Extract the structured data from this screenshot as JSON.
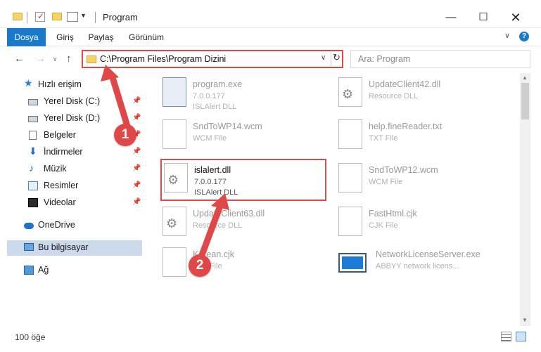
{
  "window": {
    "title": "Program",
    "min": "—",
    "max": "☐",
    "close": "✕"
  },
  "ribbon": {
    "tabs": [
      "Dosya",
      "Giriş",
      "Paylaş",
      "Görünüm"
    ],
    "chevron": "∨",
    "help": "?"
  },
  "nav": {
    "back": "←",
    "forward": "→",
    "recent": "∨",
    "up": "↑",
    "refresh": "↻",
    "drop": "∨"
  },
  "address": {
    "path": "C:\\Program Files\\Program Dizini"
  },
  "search": {
    "placeholder": "Ara: Program"
  },
  "sidebar": {
    "items": [
      {
        "label": "Hızlı erişim",
        "icon": "star-icon"
      },
      {
        "label": "Yerel Disk (C:)",
        "icon": "drive-icon",
        "pinned": true
      },
      {
        "label": "Yerel Disk (D:)",
        "icon": "drive-icon",
        "pinned": true
      },
      {
        "label": "Belgeler",
        "icon": "documents-icon",
        "pinned": true
      },
      {
        "label": "İndirmeler",
        "icon": "download-icon",
        "pinned": true
      },
      {
        "label": "Müzik",
        "icon": "music-icon",
        "pinned": true
      },
      {
        "label": "Resimler",
        "icon": "pictures-icon",
        "pinned": true
      },
      {
        "label": "Videolar",
        "icon": "videos-icon",
        "pinned": true
      },
      {
        "label": "OneDrive",
        "icon": "onedrive-icon"
      },
      {
        "label": "Bu bilgisayar",
        "icon": "computer-icon",
        "selected": true
      },
      {
        "label": "Ağ",
        "icon": "network-icon"
      }
    ],
    "pin_glyph": "📌"
  },
  "files": [
    {
      "name": "program.exe",
      "line2": "7.0.0.177",
      "line3": "ISLAlert DLL",
      "icon": "exe-file-icon"
    },
    {
      "name": "UpdateClient42.dll",
      "line2": "Resource DLL",
      "line3": "",
      "icon": "dll-file-icon"
    },
    {
      "name": "SndToWP14.wcm",
      "line2": "WCM File",
      "line3": "",
      "icon": "blank-file-icon"
    },
    {
      "name": "help.fineReader.txt",
      "line2": "TXT File",
      "line3": "",
      "icon": "blank-file-icon"
    },
    {
      "name": "islalert.dll",
      "line2": "7.0.0.177",
      "line3": "ISLAlert DLL",
      "icon": "dll-file-icon",
      "highlighted": true
    },
    {
      "name": "SndToWP12.wcm",
      "line2": "WCM File",
      "line3": "",
      "icon": "blank-file-icon"
    },
    {
      "name": "UpdateClient63.dll",
      "line2": "Resource DLL",
      "line3": "",
      "icon": "dll-file-icon"
    },
    {
      "name": "FastHtml.cjk",
      "line2": "CJK File",
      "line3": "",
      "icon": "blank-file-icon"
    },
    {
      "name": "Korean.cjk",
      "line2": "CJK File",
      "line3": "",
      "icon": "blank-file-icon"
    },
    {
      "name": "NetworkLicenseServer.exe",
      "line2": "ABBYY network licens...",
      "line3": "",
      "icon": "server-app-icon"
    }
  ],
  "status": {
    "count": "100 öğe"
  },
  "annotations": {
    "badge1": "1",
    "badge2": "2",
    "color": "#e04848"
  },
  "colors": {
    "accent": "#1979ca",
    "highlight": "#d94a4a",
    "selected": "#ccd9ea"
  }
}
